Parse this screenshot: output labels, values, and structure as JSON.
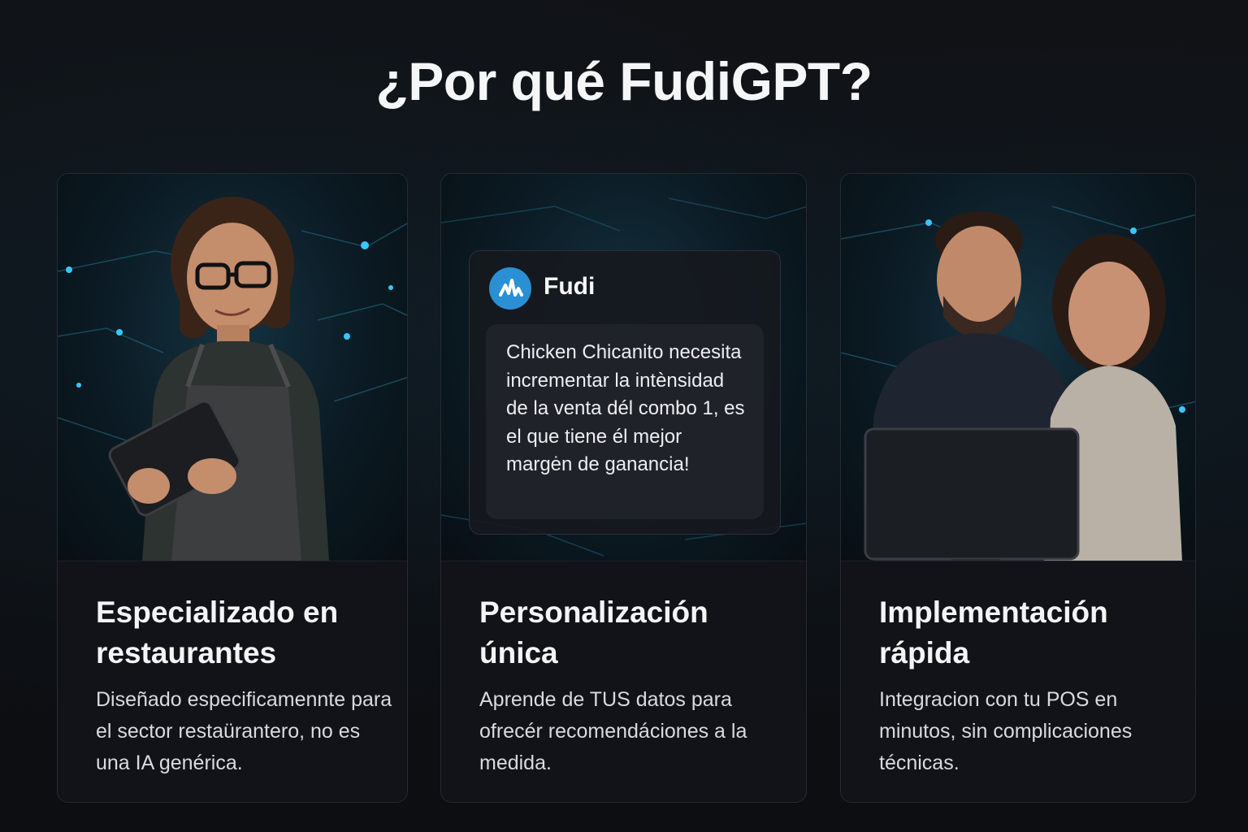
{
  "header": {
    "title": "¿Por qué FudiGPT?"
  },
  "cards": [
    {
      "title": "Especializado en restaurantes",
      "description": "Diseñado especificamennte para el sector restaürantero, no es una IA genérica.",
      "image": "woman-with-tablet-photo"
    },
    {
      "title": "Personalización única",
      "description": "Aprende de TUS datos para ofrecér recomendáciones a la medida.",
      "chat": {
        "name": "Fudi",
        "avatar_icon": "fudi-logo-icon",
        "message": "Chicken Chicanito necesita incrementar la intènsidad de la venta dél combo 1, es el que tiene él mejor margėn de ganancia!"
      }
    },
    {
      "title": "Implementación rápida",
      "description": "Integracion con tu POS en minutos, sin complicaciones técnicas.",
      "image": "team-at-computer-photo"
    }
  ],
  "colors": {
    "background": "#0e1014",
    "card": "#111318",
    "accent": "#2a8fd3",
    "glow": "#38c6ff"
  }
}
